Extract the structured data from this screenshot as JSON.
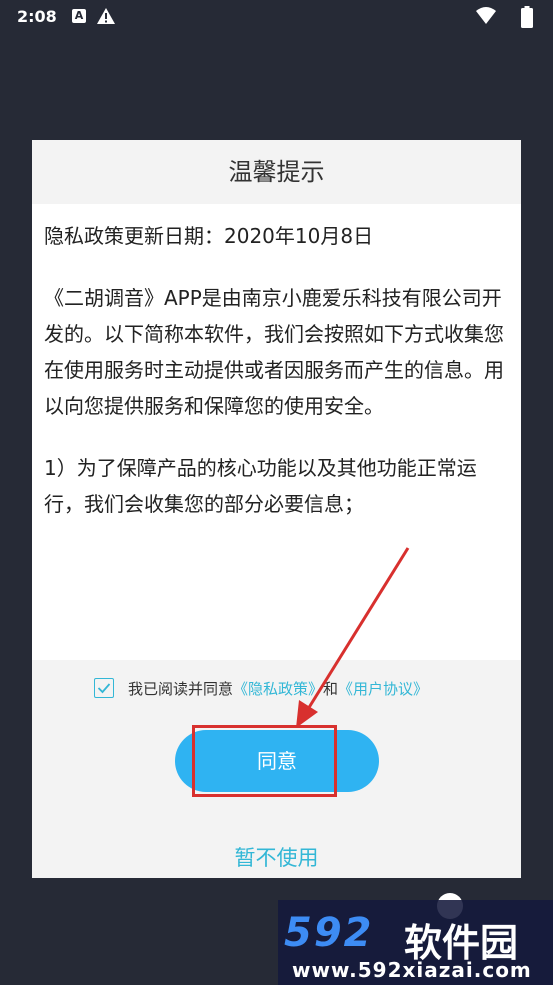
{
  "status_bar": {
    "time": "2:08",
    "icons": [
      "a-notification-icon",
      "warning-icon",
      "wifi-icon",
      "battery-icon"
    ]
  },
  "dialog": {
    "title": "温馨提示",
    "paragraphs": [
      "隐私政策更新日期：2020年10月8日",
      "《二胡调音》APP是由南京小鹿爱乐科技有限公司开发的。以下简称本软件，我们会按照如下方式收集您在使用服务时主动提供或者因服务而产生的信息。用以向您提供服务和保障您的使用安全。",
      "1）为了保障产品的核心功能以及其他功能正常运行，我们会收集您的部分必要信息；"
    ],
    "agree_prefix": "我已阅读并同意",
    "privacy_link": "《隐私政策》",
    "and_text": "和",
    "user_agreement_link": "《用户协议》",
    "checkbox_checked": true,
    "agree_label": "同意",
    "decline_label": "暂不使用"
  },
  "watermark": {
    "logo_num": "592",
    "logo_cn": "软件园",
    "url": "www.592xiazai.com"
  },
  "colors": {
    "background": "#262a36",
    "accent": "#2fb3f2",
    "link": "#33b7d6",
    "annotation_red": "#d8302e"
  }
}
